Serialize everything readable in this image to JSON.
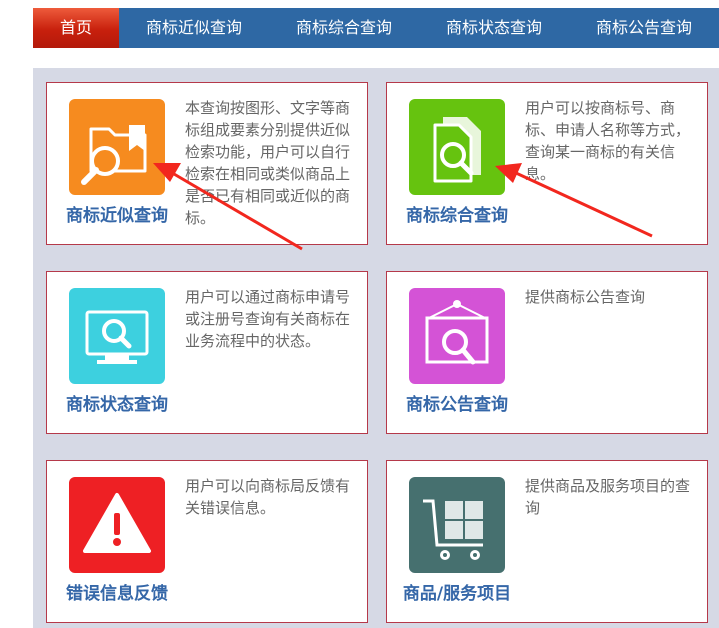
{
  "nav": {
    "items": [
      {
        "label": "首页",
        "active": true
      },
      {
        "label": "商标近似查询",
        "active": false
      },
      {
        "label": "商标综合查询",
        "active": false
      },
      {
        "label": "商标状态查询",
        "active": false
      },
      {
        "label": "商标公告查询",
        "active": false
      }
    ]
  },
  "cards": [
    {
      "title": "商标近似查询",
      "desc": "本查询按图形、文字等商标组成要素分别提供近似检索功能，用户可以自行检索在相同或类似商品上是否已有相同或近似的商标。",
      "icon": "folder-search-icon",
      "color": "#f68b1f"
    },
    {
      "title": "商标综合查询",
      "desc": "用户可以按商标号、商标、申请人名称等方式，查询某一商标的有关信息。",
      "icon": "document-search-icon",
      "color": "#66c30f"
    },
    {
      "title": "商标状态查询",
      "desc": "用户可以通过商标申请号或注册号查询有关商标在业务流程中的状态。",
      "icon": "monitor-search-icon",
      "color": "#3dd0df"
    },
    {
      "title": "商标公告查询",
      "desc": "提供商标公告查询",
      "icon": "notice-search-icon",
      "color": "#d453d6"
    },
    {
      "title": "错误信息反馈",
      "desc": "用户可以向商标局反馈有关错误信息。",
      "icon": "warning-icon",
      "color": "#ee2024"
    },
    {
      "title": "商品/服务项目",
      "desc": "提供商品及服务项目的查询",
      "icon": "cart-icon",
      "color": "#46706f"
    }
  ]
}
